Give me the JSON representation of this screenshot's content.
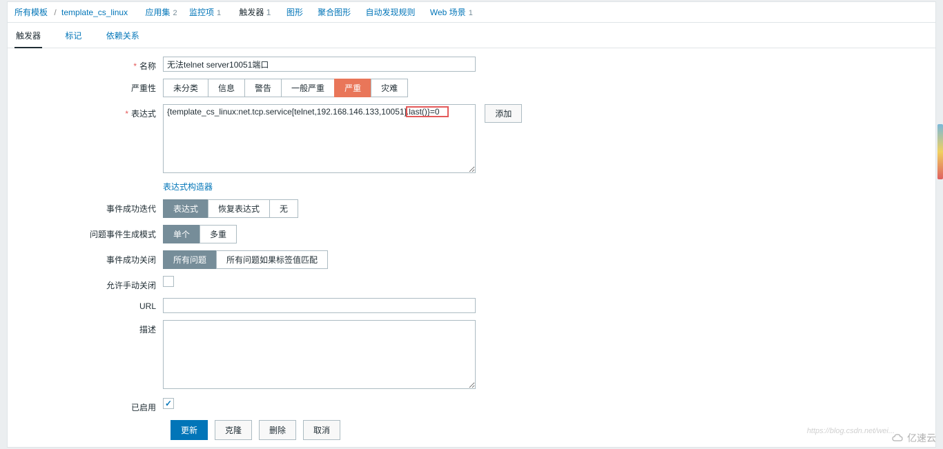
{
  "breadcrumb": {
    "all_templates": "所有模板",
    "template_name": "template_cs_linux",
    "apps": "应用集",
    "apps_count": "2",
    "items": "监控项",
    "items_count": "1",
    "triggers": "触发器",
    "triggers_count": "1",
    "graphs": "图形",
    "screens": "聚合图形",
    "discovery": "自动发现规则",
    "web": "Web 场景",
    "web_count": "1"
  },
  "tabs": {
    "trigger": "触发器",
    "tags": "标记",
    "deps": "依赖关系"
  },
  "form": {
    "name_label": "名称",
    "name_value": "无法telnet server10051端口",
    "severity_label": "严重性",
    "sev_unclassified": "未分类",
    "sev_info": "信息",
    "sev_warning": "警告",
    "sev_average": "一般严重",
    "sev_high": "严重",
    "sev_disaster": "灾难",
    "expression_label": "表达式",
    "expression_value": "{template_cs_linux:net.tcp.service[telnet,192.168.146.133,10051].last()}=0",
    "add_btn": "添加",
    "expression_builder": "表达式构造器",
    "ok_event_gen_label": "事件成功迭代",
    "ok_expression": "表达式",
    "ok_recovery": "恢复表达式",
    "ok_none": "无",
    "problem_gen_label": "问题事件生成模式",
    "problem_single": "单个",
    "problem_multiple": "多重",
    "ok_close_label": "事件成功关闭",
    "close_all": "所有问题",
    "close_tag": "所有问题如果标签值匹配",
    "manual_close_label": "允许手动关闭",
    "url_label": "URL",
    "url_value": "",
    "desc_label": "描述",
    "desc_value": "",
    "enabled_label": "已启用",
    "update_btn": "更新",
    "clone_btn": "克隆",
    "delete_btn": "删除",
    "cancel_btn": "取消"
  },
  "watermark": "https://blog.csdn.net/wei...",
  "logo": "亿速云"
}
